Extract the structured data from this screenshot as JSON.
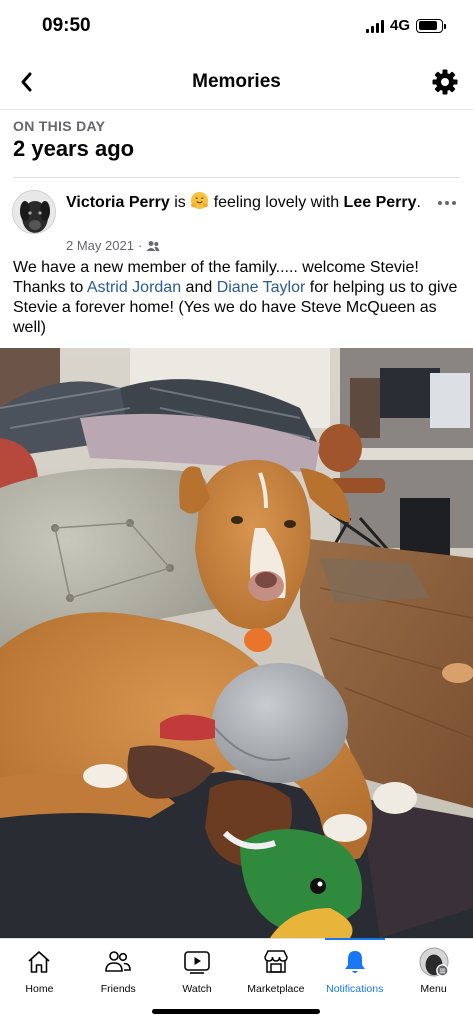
{
  "status_bar": {
    "time": "09:50",
    "network": "4G",
    "battery_level": 0.85
  },
  "header": {
    "title": "Memories",
    "back_icon": "chevron-left-icon",
    "settings_icon": "gear-icon"
  },
  "memory": {
    "label": "ON THIS DAY",
    "years_ago": "2 years ago"
  },
  "post": {
    "author": "Victoria Perry",
    "is_text": "is",
    "feeling_emoji": "hugging-face-emoji",
    "feeling_text": "feeling lovely with",
    "tagged_friend": "Lee Perry",
    "tagged_suffix": ".",
    "date": "2 May 2021",
    "meta_separator": "·",
    "audience_icon": "friends-audience-icon",
    "body": {
      "part1": "We have a new member of the family..... welcome Stevie! Thanks to ",
      "link1": "Astrid Jordan",
      "part2": " and ",
      "link2": "Diane Taylor",
      "part3": " for helping us to give Stevie a forever home! (Yes we do have Steve McQueen as well)"
    },
    "photo_subject": "dog-with-duck-toy-photo"
  },
  "bottom_nav": {
    "items": [
      {
        "label": "Home",
        "icon": "home-icon"
      },
      {
        "label": "Friends",
        "icon": "friends-icon"
      },
      {
        "label": "Watch",
        "icon": "watch-icon"
      },
      {
        "label": "Marketplace",
        "icon": "marketplace-icon"
      },
      {
        "label": "Notifications",
        "icon": "bell-icon",
        "active": true
      },
      {
        "label": "Menu",
        "icon": "profile-avatar-icon"
      }
    ]
  },
  "colors": {
    "accent": "#1877f2",
    "link": "#2a5a9a",
    "secondary_text": "#65676b"
  }
}
